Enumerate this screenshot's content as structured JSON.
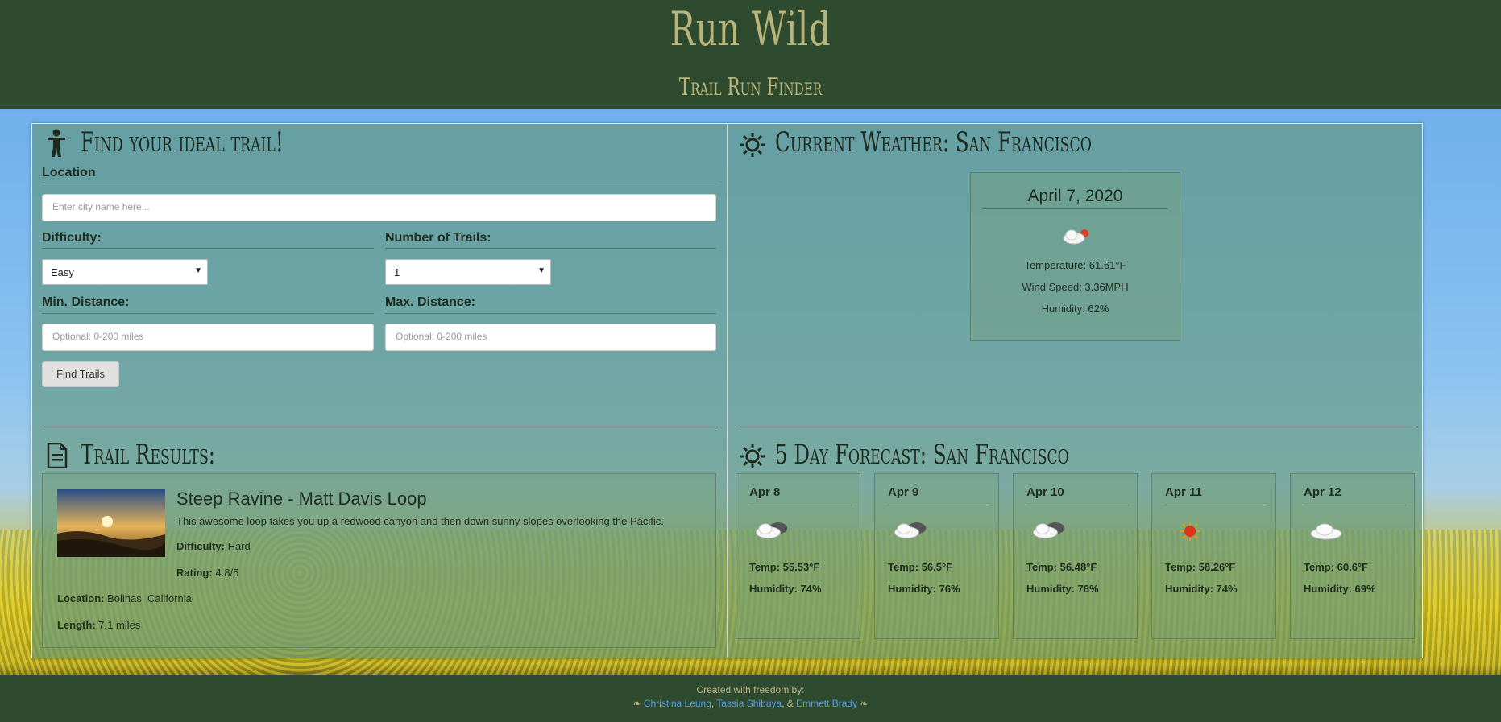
{
  "header": {
    "title": "Run Wild",
    "subtitle": "Trail Run Finder"
  },
  "search": {
    "title": "Find your ideal trail!",
    "location_label": "Location",
    "location_placeholder": "Enter city name here...",
    "difficulty_label": "Difficulty:",
    "difficulty_value": "Easy",
    "num_trails_label": "Number of Trails:",
    "num_trails_value": "1",
    "min_label": "Min. Distance:",
    "min_placeholder": "Optional: 0-200 miles",
    "max_label": "Max. Distance:",
    "max_placeholder": "Optional: 0-200 miles",
    "button": "Find Trails"
  },
  "results": {
    "title": "Trail Results:",
    "trail": {
      "name": "Steep Ravine - Matt Davis Loop",
      "description": "This awesome loop takes you up a redwood canyon and then down sunny slopes overlooking the Pacific.",
      "difficulty_label": "Difficulty:",
      "difficulty": "Hard",
      "rating_label": "Rating:",
      "rating": "4.8/5",
      "location_label": "Location:",
      "location": "Bolinas, California",
      "length_label": "Length:",
      "length": "7.1 miles"
    }
  },
  "current": {
    "title": "Current Weather: San Francisco",
    "date": "April 7, 2020",
    "icon": "partly-cloudy-icon",
    "temperature": "Temperature: 61.61°F",
    "wind": "Wind Speed: 3.36MPH",
    "humidity": "Humidity: 62%"
  },
  "forecast": {
    "title": "5 Day Forecast: San Francisco",
    "days": [
      {
        "date": "Apr 8",
        "icon": "cloudy-icon",
        "temp": "Temp: 55.53°F",
        "humidity": "Humidity: 74%"
      },
      {
        "date": "Apr 9",
        "icon": "cloudy-icon",
        "temp": "Temp: 56.5°F",
        "humidity": "Humidity: 76%"
      },
      {
        "date": "Apr 10",
        "icon": "cloudy-icon",
        "temp": "Temp: 56.48°F",
        "humidity": "Humidity: 78%"
      },
      {
        "date": "Apr 11",
        "icon": "sun-icon",
        "temp": "Temp: 58.26°F",
        "humidity": "Humidity: 74%"
      },
      {
        "date": "Apr 12",
        "icon": "cloud-icon",
        "temp": "Temp: 60.6°F",
        "humidity": "Humidity: 69%"
      }
    ]
  },
  "footer": {
    "line1": "Created with freedom by:",
    "author1": "Christina Leung",
    "sep1": ",",
    "author2": "Tassia Shibuya",
    "sep2": ", &",
    "author3": "Emmett Brady"
  },
  "colors": {
    "header_bg": "#2f4b2f",
    "title_color": "#b9b47a",
    "link_color": "#5b9ddc"
  }
}
